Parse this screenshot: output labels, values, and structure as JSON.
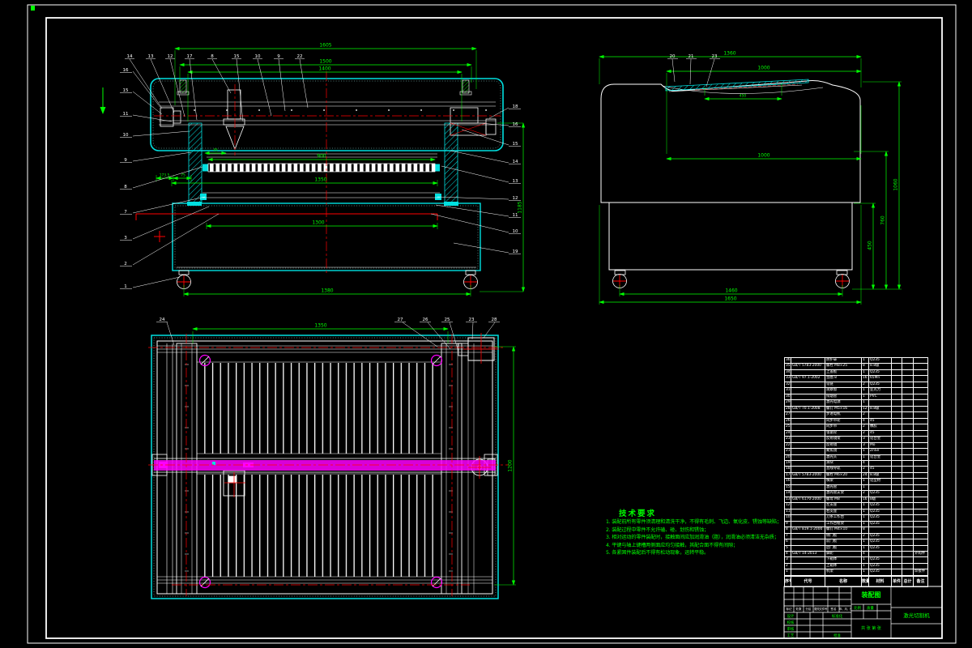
{
  "views": {
    "front": {
      "dims": {
        "overall_width": "1605",
        "frame_width": "1500",
        "rail_width": "1400",
        "head_offset": "45",
        "col_left": "173.5",
        "col_right": "75",
        "table_width": "900",
        "table_mid": "1350",
        "table_inner": "1300",
        "wheel_base": "1380",
        "overall_height": "1185"
      },
      "balloons_top": [
        "14",
        "13",
        "12",
        "17",
        "8",
        "15",
        "10",
        "9",
        "22"
      ],
      "balloons_left": [
        "16",
        "15",
        "11",
        "10",
        "9",
        "8",
        "7",
        "3",
        "2",
        "1"
      ],
      "balloons_right": [
        "18",
        "16",
        "15",
        "14",
        "13",
        "12",
        "11",
        "10",
        "19"
      ]
    },
    "side": {
      "dims": {
        "overall_top": "1360",
        "cover_width": "1000",
        "lid_opening": "450",
        "cover_mid": "1000",
        "height_total": "1060",
        "height_mid": "760",
        "height_base": "450",
        "wheel_base": "1460",
        "overall_depth": "1650"
      },
      "balloons_top": [
        "20",
        "21",
        "23"
      ]
    },
    "plan": {
      "dims": {
        "work_width": "1350",
        "work_depth": "1200"
      },
      "balloons_top": [
        "24",
        "27",
        "26",
        "25",
        "23",
        "28"
      ]
    }
  },
  "tech_requirements": {
    "title": "技术要求",
    "items": [
      "1. 装配前所有零件须清理和清洗干净，不得有毛刺、飞边、氧化皮、锈蚀等缺陷；",
      "2. 装配过程中零件不允许磕、碰、划伤和锈蚀；",
      "3. 相对运动的零件装配时，接触面间应加润滑油（脂），润滑油必须清洁无杂质；",
      "4. 平键与轴上键槽两侧面应均匀接触，其配合面不得有间隙；",
      "5. 各紧固件装配后不得有松动现象，运转平稳。"
    ]
  },
  "bom": {
    "headers": [
      "序号",
      "代号",
      "名称",
      "数量",
      "材料",
      "单件",
      "总计",
      "备注"
    ],
    "rows": [
      [
        "36",
        "",
        "防护罩",
        "1",
        "Q235",
        "",
        "",
        ""
      ],
      [
        "35",
        "GB/T 5783-2000",
        "螺栓 M8×25",
        "8",
        "8.8级",
        "",
        "",
        ""
      ],
      [
        "34",
        "",
        "上盖板",
        "1",
        "Q235",
        "",
        "",
        ""
      ],
      [
        "33",
        "GB/T 97.1-2002",
        "垫圈 8",
        "16",
        "65Mn",
        "",
        "",
        ""
      ],
      [
        "32",
        "",
        "铰链",
        "2",
        "Q235",
        "",
        "",
        ""
      ],
      [
        "31",
        "",
        "观察窗",
        "1",
        "亚克力",
        "",
        "",
        ""
      ],
      [
        "30",
        "",
        "排烟管",
        "1",
        "PVC",
        "",
        "",
        ""
      ],
      [
        "29",
        "",
        "激光电源",
        "1",
        "",
        "",
        "",
        ""
      ],
      [
        "28",
        "GB/T 70.1-2008",
        "螺钉 M5×16",
        "12",
        "8.8级",
        "",
        "",
        ""
      ],
      [
        "27",
        "",
        "步进电机",
        "2",
        "",
        "",
        "",
        ""
      ],
      [
        "26",
        "",
        "同步带轮",
        "4",
        "45",
        "",
        "",
        ""
      ],
      [
        "25",
        "",
        "同步带",
        "2",
        "橡胶",
        "",
        "",
        ""
      ],
      [
        "24",
        "",
        "张紧轮",
        "2",
        "45",
        "",
        "",
        ""
      ],
      [
        "23",
        "",
        "反射镜架",
        "3",
        "铝合金",
        "",
        "",
        ""
      ],
      [
        "22",
        "",
        "反射镜",
        "3",
        "Mo",
        "",
        "",
        ""
      ],
      [
        "21",
        "",
        "聚焦镜",
        "1",
        "ZnSe",
        "",
        "",
        ""
      ],
      [
        "20",
        "",
        "激光头",
        "1",
        "铝合金",
        "",
        "",
        ""
      ],
      [
        "19",
        "",
        "滑块",
        "4",
        "",
        "",
        "",
        ""
      ],
      [
        "18",
        "",
        "直线导轨",
        "2",
        "45",
        "",
        "",
        ""
      ],
      [
        "17",
        "GB/T 5783-2000",
        "螺栓 M6×20",
        "24",
        "8.8级",
        "",
        "",
        ""
      ],
      [
        "16",
        "",
        "横梁",
        "1",
        "铝型材",
        "",
        "",
        ""
      ],
      [
        "15",
        "",
        "激光管",
        "1",
        "",
        "",
        "",
        ""
      ],
      [
        "14",
        "",
        "激光管支架",
        "2",
        "Q235",
        "",
        "",
        ""
      ],
      [
        "13",
        "GB/T 6170-2000",
        "螺母 M8",
        "16",
        "8级",
        "",
        "",
        ""
      ],
      [
        "12",
        "",
        "左支座",
        "1",
        "Q235",
        "",
        "",
        ""
      ],
      [
        "11",
        "",
        "右支座",
        "1",
        "Q235",
        "",
        "",
        ""
      ],
      [
        "10",
        "",
        "刀条工作台",
        "1",
        "Q235",
        "",
        "",
        ""
      ],
      [
        "9",
        "",
        "工作台框架",
        "1",
        "Q235",
        "",
        "",
        ""
      ],
      [
        "8",
        "GB/T 819.1-2000",
        "螺钉 M4×10",
        "8",
        "",
        "",
        "",
        ""
      ],
      [
        "7",
        "",
        "侧门板",
        "2",
        "Q235",
        "",
        "",
        ""
      ],
      [
        "6",
        "",
        "前门板",
        "1",
        "Q235",
        "",
        "",
        ""
      ],
      [
        "5",
        "",
        "后门板",
        "1",
        "Q235",
        "",
        "",
        ""
      ],
      [
        "4",
        "GB/T 14-2013",
        "脚轮",
        "4",
        "",
        "",
        "",
        "外购件"
      ],
      [
        "3",
        "",
        "下箱体",
        "1",
        "Q235",
        "",
        "",
        ""
      ],
      [
        "2",
        "",
        "上箱体",
        "1",
        "Q235",
        "",
        "",
        ""
      ],
      [
        "1",
        "",
        "机架",
        "1",
        "Q235",
        "",
        "",
        "焊接件"
      ]
    ]
  },
  "title_block": {
    "drawing_title": "装配图",
    "product_name": "激光切割机",
    "rev_headers": [
      "标记",
      "处数",
      "分区",
      "更改文件号",
      "签名",
      "年、月、日"
    ],
    "sign_labels": [
      "设计",
      "校核",
      "审核",
      "工艺"
    ],
    "approve_labels": [
      "标准化",
      "批准"
    ],
    "scale_label": "比例",
    "mass_label": "质量",
    "sheet_label": "共 张 第 张"
  },
  "colors": {
    "background": "#000000",
    "line": "#ffffff",
    "dimension": "#00ff00",
    "outline_cyan": "#00e0e0",
    "axis_red": "#ff0000",
    "beam_magenta": "#ff00ff"
  }
}
